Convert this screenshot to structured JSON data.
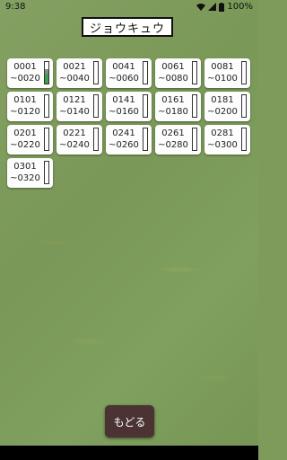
{
  "status": {
    "time": "9:38",
    "battery": "100%"
  },
  "title": "ジョウキュウ",
  "cells": [
    {
      "start": "0001",
      "end": "~0020",
      "progress_green": 0.45,
      "progress_gray": 0.2
    },
    {
      "start": "0021",
      "end": "~0040"
    },
    {
      "start": "0041",
      "end": "~0060"
    },
    {
      "start": "0061",
      "end": "~0080"
    },
    {
      "start": "0081",
      "end": "~0100"
    },
    {
      "start": "0101",
      "end": "~0120"
    },
    {
      "start": "0121",
      "end": "~0140"
    },
    {
      "start": "0141",
      "end": "~0160"
    },
    {
      "start": "0161",
      "end": "~0180"
    },
    {
      "start": "0181",
      "end": "~0200"
    },
    {
      "start": "0201",
      "end": "~0220"
    },
    {
      "start": "0221",
      "end": "~0240"
    },
    {
      "start": "0241",
      "end": "~0260"
    },
    {
      "start": "0261",
      "end": "~0280"
    },
    {
      "start": "0281",
      "end": "~0300"
    },
    {
      "start": "0301",
      "end": "~0320"
    }
  ],
  "back_label": "もどる"
}
